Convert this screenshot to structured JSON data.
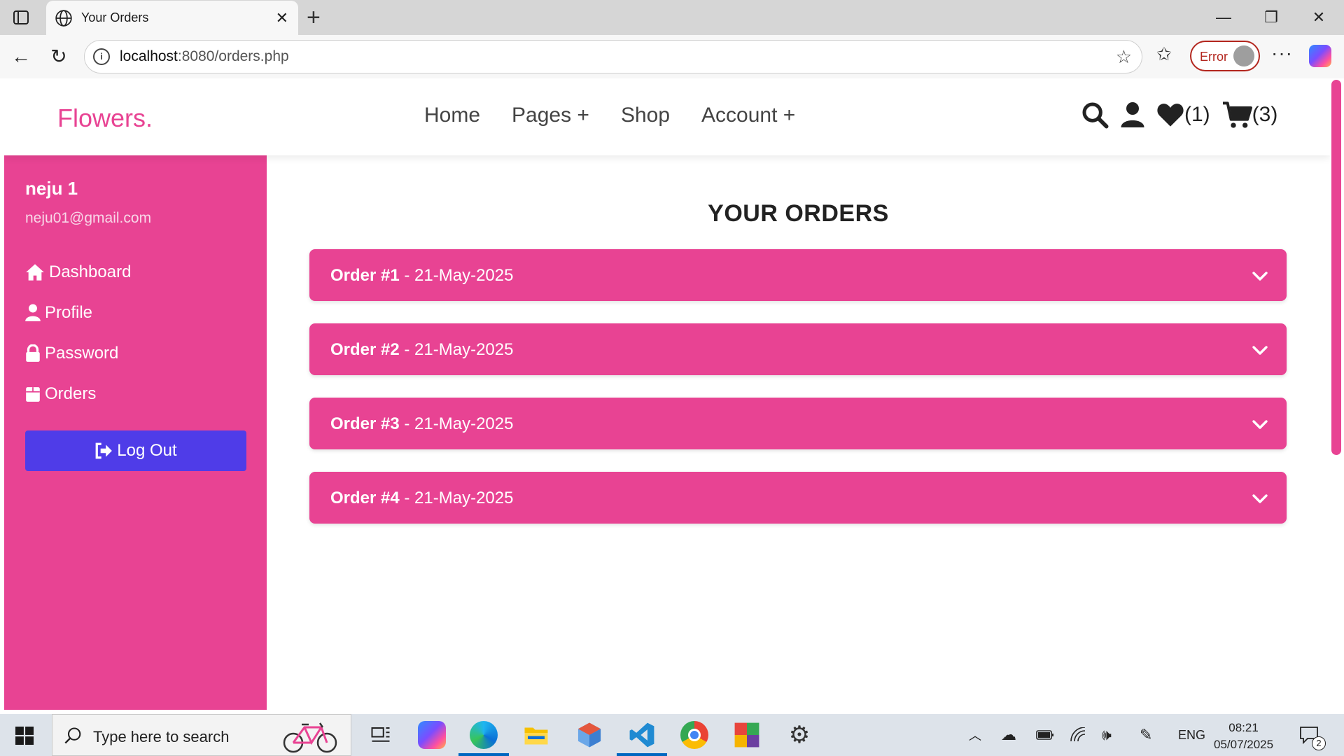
{
  "browser": {
    "tab_title": "Your Orders",
    "url_host": "localhost",
    "url_path": ":8080/orders.php",
    "profile_status": "Error"
  },
  "site": {
    "logo": "Flowers.",
    "nav": [
      "Home",
      "Pages +",
      "Shop",
      "Account +"
    ],
    "wishlist_count": "(1)",
    "cart_count": "(3)",
    "accent_color": "#e84393"
  },
  "sidebar": {
    "user_name": "neju 1",
    "user_email": "neju01@gmail.com",
    "items": [
      {
        "label": "Dashboard",
        "icon": "home-icon"
      },
      {
        "label": "Profile",
        "icon": "user-icon"
      },
      {
        "label": "Password",
        "icon": "lock-icon"
      },
      {
        "label": "Orders",
        "icon": "box-icon"
      }
    ],
    "logout_label": "Log Out",
    "logout_color": "#4f3ce8"
  },
  "main": {
    "title": "YOUR ORDERS",
    "orders": [
      {
        "id": "Order #1",
        "date": "- 21-May-2025"
      },
      {
        "id": "Order #2",
        "date": "- 21-May-2025"
      },
      {
        "id": "Order #3",
        "date": "- 21-May-2025"
      },
      {
        "id": "Order #4",
        "date": "- 21-May-2025"
      }
    ]
  },
  "taskbar": {
    "search_placeholder": "Type here to search",
    "language": "ENG",
    "time": "08:21",
    "date": "05/07/2025",
    "notification_count": "2"
  }
}
